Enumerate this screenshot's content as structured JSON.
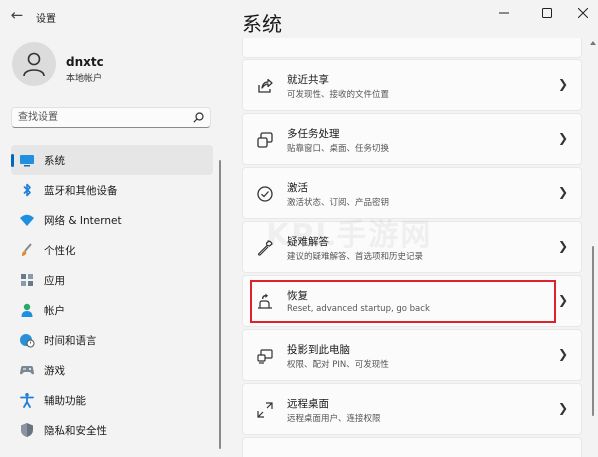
{
  "titlebar": {
    "back_icon": "arrow-left-icon",
    "app_title": "设置",
    "minimize_icon": "minimize-icon",
    "maximize_icon": "maximize-icon",
    "close_icon": "close-icon"
  },
  "profile": {
    "name": "dnxtc",
    "account_type": "本地帐户"
  },
  "search": {
    "placeholder": "查找设置",
    "icon": "search-icon"
  },
  "sidebar": {
    "selected_index": 0,
    "items": [
      {
        "label": "系统",
        "icon": "monitor-icon"
      },
      {
        "label": "蓝牙和其他设备",
        "icon": "bluetooth-icon"
      },
      {
        "label": "网络 & Internet",
        "icon": "wifi-icon"
      },
      {
        "label": "个性化",
        "icon": "brush-icon"
      },
      {
        "label": "应用",
        "icon": "apps-icon"
      },
      {
        "label": "帐户",
        "icon": "person-icon"
      },
      {
        "label": "时间和语言",
        "icon": "globe-clock-icon"
      },
      {
        "label": "游戏",
        "icon": "gamepad-icon"
      },
      {
        "label": "辅助功能",
        "icon": "accessibility-icon"
      },
      {
        "label": "隐私和安全性",
        "icon": "shield-icon"
      }
    ]
  },
  "main": {
    "title": "系统",
    "cards": [
      {
        "title": "就近共享",
        "subtitle": "可发现性、接收的文件位置",
        "icon": "share-icon"
      },
      {
        "title": "多任务处理",
        "subtitle": "贴靠窗口、桌面、任务切换",
        "icon": "multitask-icon"
      },
      {
        "title": "激活",
        "subtitle": "激活状态、订阅、产品密钥",
        "icon": "check-circle-icon"
      },
      {
        "title": "疑难解答",
        "subtitle": "建议的疑难解答、首选项和历史记录",
        "icon": "wrench-icon"
      },
      {
        "title": "恢复",
        "subtitle": "Reset, advanced startup, go back",
        "icon": "recovery-icon",
        "highlighted": true
      },
      {
        "title": "投影到此电脑",
        "subtitle": "权限、配对 PIN、可发现性",
        "icon": "project-icon"
      },
      {
        "title": "远程桌面",
        "subtitle": "远程桌面用户、连接权限",
        "icon": "remote-desktop-icon"
      }
    ],
    "chevron_icon": "chevron-right-icon"
  },
  "watermark": "KPL手游网",
  "colors": {
    "accent": "#0067c0",
    "highlight_border": "#e0202b",
    "background": "#f3f3f3",
    "card": "#fbfbfb"
  }
}
